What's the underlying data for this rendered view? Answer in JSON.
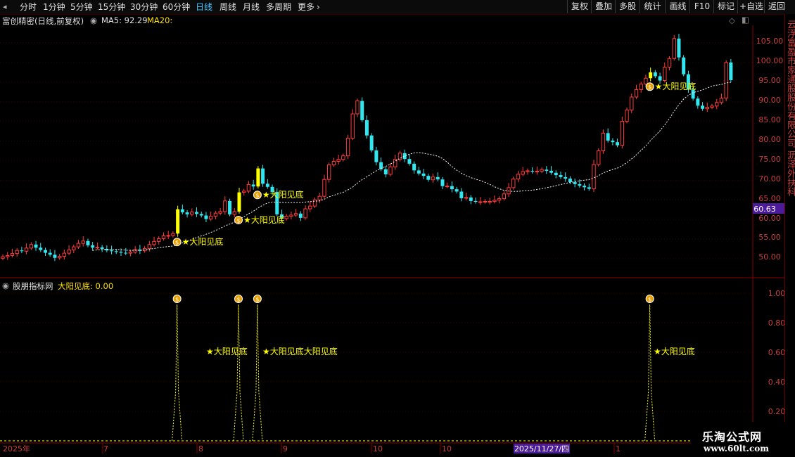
{
  "toolbar": {
    "periods": [
      "分时",
      "1分钟",
      "5分钟",
      "15分钟",
      "30分钟",
      "60分钟",
      "日线",
      "周线",
      "月线",
      "多周期"
    ],
    "active_period": "日线",
    "more": "更多",
    "right": [
      "复权",
      "叠加",
      "多股",
      "统计",
      "画线",
      "F10",
      "标记",
      "+自选",
      "返回"
    ]
  },
  "main": {
    "stock_title": "富创精密(日线,前复权)",
    "ma5": "MA5: 92.29",
    "ma20": "MA20:",
    "price_ticks": [
      "105.00",
      "100.00",
      "95.00",
      "90.00",
      "85.00",
      "80.00",
      "75.00",
      "70.00",
      "65.00",
      "60.00",
      "55.00",
      "50.00"
    ],
    "current_price": "60.63",
    "signal_label": "★大阳见底"
  },
  "sub": {
    "title": "股朋指标网",
    "indicator": "大阳见底: 0.00",
    "ticks": [
      "1.00",
      "0.80",
      "0.60",
      "0.40",
      "0.20"
    ],
    "overlap_label": "★大阳见底大阳见底"
  },
  "axis": {
    "labels": [
      "2025年",
      "7",
      "8",
      "9",
      "10",
      "11",
      "1"
    ],
    "cursor_date": "2025/11/27/四"
  },
  "side_text": "云浮富盈市家通股股份有限公司 沥泽外扶科",
  "watermark": {
    "line1": "乐淘公式网",
    "line2": "www.60lt.com"
  },
  "colors": {
    "up": "#ff3c3c",
    "down": "#32e6f0",
    "signal": "#ffff00",
    "axis": "#8b0000",
    "grid": "#3a0000"
  },
  "chart_data": {
    "type": "candlestick",
    "y_range": [
      47,
      108
    ],
    "closes": [
      50.5,
      50.8,
      51.3,
      52.1,
      51.9,
      52.7,
      53.6,
      52.8,
      52.2,
      51.5,
      51.0,
      50.2,
      50.6,
      51.4,
      52.2,
      53.0,
      53.9,
      54.5,
      53.4,
      52.8,
      52.9,
      52.5,
      52.1,
      51.9,
      51.7,
      51.5,
      51.4,
      51.7,
      52.3,
      52.0,
      52.6,
      53.6,
      54.4,
      55.1,
      55.8,
      55.9,
      56.4,
      62.6,
      61.8,
      61.3,
      61.9,
      61.4,
      61.0,
      60.1,
      60.8,
      61.6,
      62.0,
      64.7,
      61.3,
      62.0,
      66.9,
      67.2,
      68.9,
      68.4,
      73.0,
      69.1,
      68.3,
      67.0,
      61.3,
      60.2,
      60.8,
      61.1,
      61.5,
      60.4,
      62.7,
      63.4,
      65.0,
      65.9,
      70.2,
      73.9,
      74.8,
      75.3,
      76.2,
      80.7,
      86.9,
      90.2,
      85.3,
      81.4,
      77.6,
      74.6,
      72.8,
      71.5,
      73.4,
      75.3,
      76.9,
      75.4,
      74.2,
      72.5,
      71.7,
      71.1,
      70.1,
      70.8,
      70.2,
      68.5,
      68.5,
      67.7,
      67.1,
      65.4,
      65.6,
      64.7,
      64.5,
      64.5,
      64.6,
      64.6,
      64.9,
      65.3,
      66.5,
      68.1,
      70.3,
      71.5,
      72.2,
      72.4,
      72.2,
      72.3,
      72.7,
      72.4,
      71.9,
      71.3,
      70.8,
      70.4,
      69.5,
      69.0,
      68.6,
      68.2,
      67.8,
      74.0,
      77.5,
      82.0,
      80.1,
      79.7,
      78.9,
      85.0,
      87.9,
      91.2,
      93.1,
      94.5,
      96.0,
      97.5,
      96.5,
      95.4,
      98.8,
      101.0,
      106.1,
      101.3,
      97.0,
      93.1,
      90.8,
      89.0,
      88.2,
      88.6,
      88.9,
      89.8,
      90.9,
      100.0,
      95.5
    ],
    "signals": [
      37,
      50,
      54,
      137
    ]
  }
}
